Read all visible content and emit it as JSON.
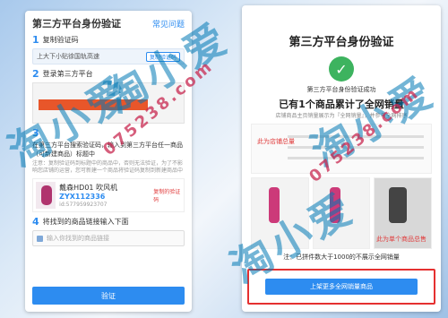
{
  "left": {
    "title": "第三方平台身份验证",
    "help": "常见问题",
    "step1_num": "1",
    "step1_label": "复制验证码",
    "code_text": "上大下小贴徐国轨高速",
    "copy_label": "复制验证码",
    "step2_num": "2",
    "step2_label": "登录第三方平台",
    "step3_num": "3",
    "step3_text": "在第三方平台搜索验证码，输入到第三方平台任一商品（可新建商品）标题中",
    "step3_hint": "注意：复制验证码到标题中的商品中，否则无法验证，为了不影响您店铺的运营，您可新建一个商品将验证码复制到新建商品中",
    "product_name": "戴森HD01 吹风机",
    "product_code": "ZYX112336",
    "product_id": "id:577959923707",
    "product_tag": "复制的验证码",
    "step4_num": "4",
    "step4_label": "将找到的商品链接输入下面",
    "link_placeholder": "输入你找到的商品链接",
    "verify_button": "验证"
  },
  "right": {
    "title": "第三方平台身份验证",
    "success": "第三方平台身份验证成功",
    "count_text": "已有1个商品累计了全网销量",
    "desc": "店铺商品主页销量展示为『全网销量』，并参与全网排序",
    "store_label": "此为店铺总量",
    "single_label": "此为单个商品总售",
    "note": "注：已拼件数大于1000的不展示全网销量",
    "upload_button": "上架更多全网销量商品"
  },
  "watermark": {
    "brand": "淘小爱",
    "number": "075238.com"
  },
  "colors": {
    "primary": "#2d8cf0",
    "success": "#3db35f",
    "highlight": "#e53030",
    "red_text": "#e03b3b"
  },
  "icons": {
    "check": "check-icon",
    "link": "link-icon"
  }
}
